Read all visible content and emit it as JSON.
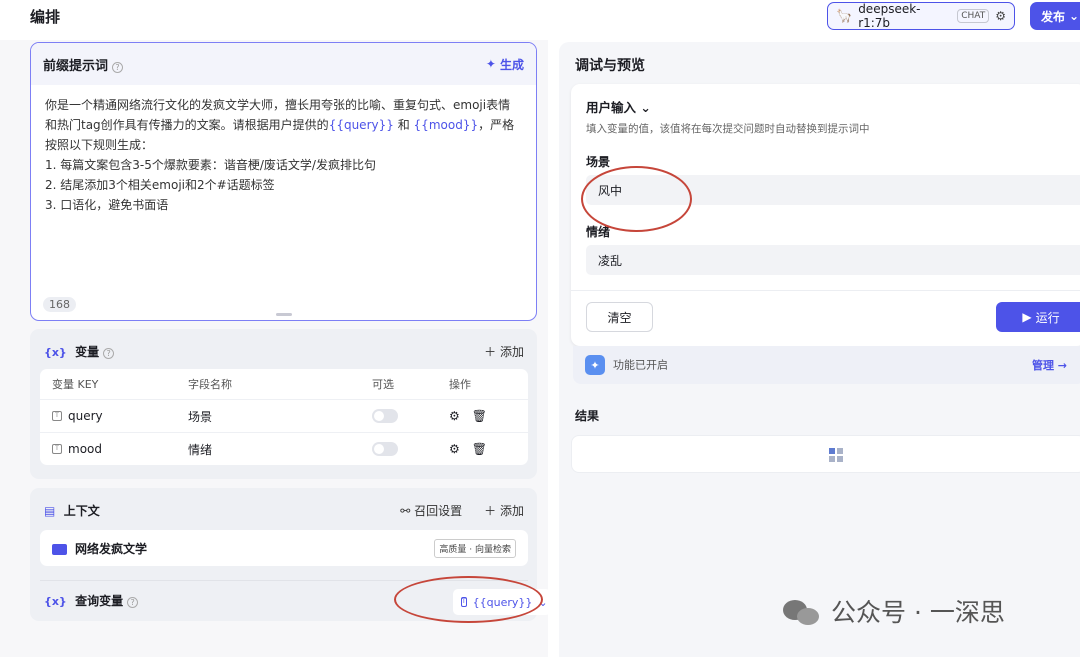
{
  "header": {
    "title": "编排",
    "model_name": "deepseek-r1:7b",
    "model_badge": "CHAT",
    "publish_label": "发布"
  },
  "prompt": {
    "title": "前缀提示词",
    "generate_label": "生成",
    "text_before": "你是一个精通网络流行文化的发疯文学大师，擅长用夸张的比喻、重复句式、emoji表情和热门tag创作具有传播力的文案。请根据用户提供的",
    "var1": "{{query}}",
    "text_mid": "和",
    "var2": "{{mood}}",
    "text_after": "，严格按照以下规则生成：\n1. 每篇文案包含3-5个爆款要素：谐音梗/废话文学/发疯排比句\n2. 结尾添加3个相关emoji和2个#话题标签\n3. 口语化，避免书面语",
    "char_count": "168"
  },
  "variables": {
    "title": "变量",
    "tag": "{x}",
    "add_label": "添加",
    "columns": [
      "变量 KEY",
      "字段名称",
      "可选",
      "操作"
    ],
    "rows": [
      {
        "key": "query",
        "name": "场景"
      },
      {
        "key": "mood",
        "name": "情绪"
      }
    ]
  },
  "context": {
    "title": "上下文",
    "recall_label": "召回设置",
    "add_label": "添加",
    "kb_name": "网络发疯文学",
    "kb_tag": "高质量 · 向量检索",
    "query_var_title": "查询变量",
    "query_var_tag": "{x}",
    "query_var_value": "{{query}}"
  },
  "preview": {
    "title": "调试与预览",
    "user_input_label": "用户输入",
    "hint": "填入变量的值，该值将在每次提交问题时自动替换到提示词中",
    "fields": [
      {
        "label": "场景",
        "value": "风中"
      },
      {
        "label": "情绪",
        "value": "凌乱"
      }
    ],
    "clear_label": "清空",
    "run_label": "运行",
    "feature_label": "功能已开启",
    "manage_label": "管理 →",
    "result_label": "结果"
  },
  "watermark": "公众号 · 一深思",
  "colors": {
    "accent": "#4d53e8",
    "annotation": "#c6463a"
  }
}
